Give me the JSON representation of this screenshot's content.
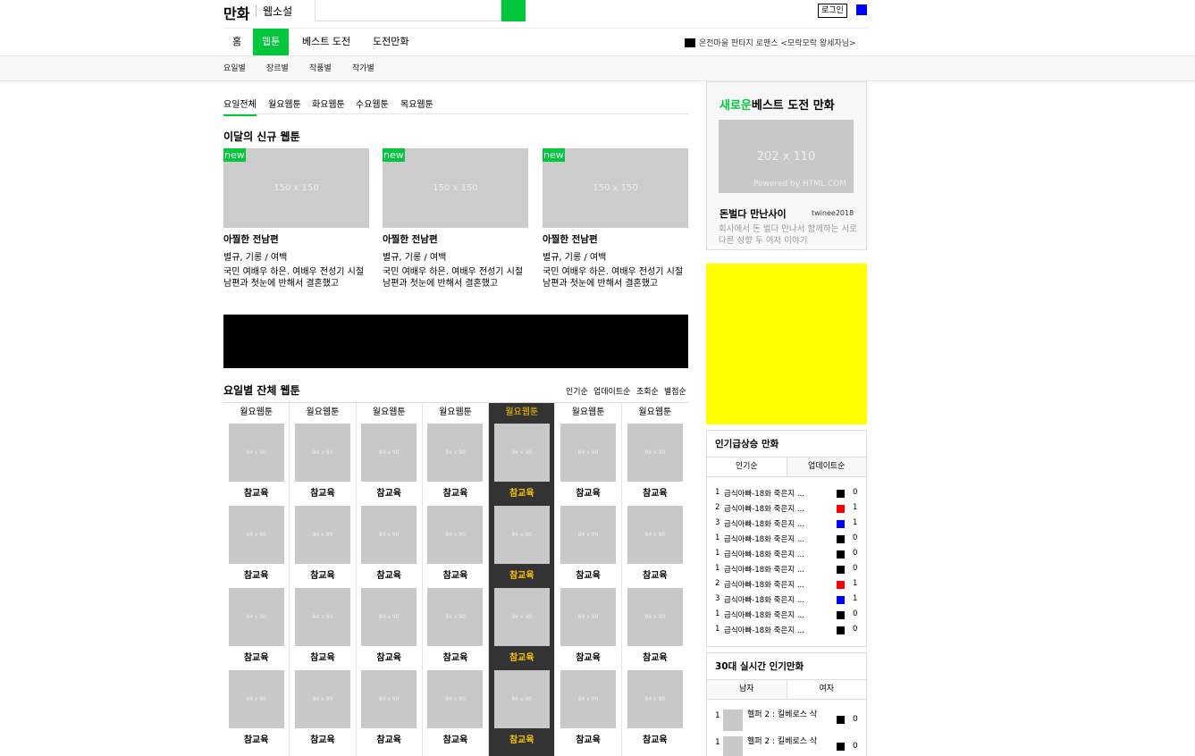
{
  "header": {
    "brand": "만화",
    "brand_sub": "웹소설",
    "search_placeholder": "",
    "login_label": "로그인",
    "colors": {
      "accent": "#00c73c",
      "user_badge": "#0000ff"
    }
  },
  "gnb": {
    "items": [
      "홈",
      "웹툰",
      "베스트 도전",
      "도전만화"
    ],
    "active": "웹툰",
    "notice": "온전마을 판타지 로맨스 <모락모락 왕세자님>"
  },
  "lnb": {
    "items": [
      "요일별",
      "장르별",
      "작품별",
      "작가별"
    ]
  },
  "day_tabs": {
    "items": [
      "요일전체",
      "월요웹툰",
      "화요웹툰",
      "수요웹툰",
      "목요웹툰"
    ],
    "active": "요일전체"
  },
  "new_section": {
    "title": "이달의 신규 웹툰",
    "cards": [
      {
        "badge": "new",
        "thumb": "150 x 150",
        "name": "아찔한 전남편",
        "genre": "별규, 기롱 / 여백",
        "desc": "국민 여배우 하은. 여배우 전성기 시절 남편과 첫눈에 반해서 결혼했고"
      },
      {
        "badge": "new",
        "thumb": "150 x 150",
        "name": "아찔한 전남편",
        "genre": "별규, 기롱 / 여백",
        "desc": "국민 여배우 하은. 여배우 전성기 시절 남편과 첫눈에 반해서 결혼했고"
      },
      {
        "badge": "new",
        "thumb": "150 x 150",
        "name": "아찔한 전남편",
        "genre": "별규, 기롱 / 여백",
        "desc": "국민 여배우 하은. 여배우 전성기 시절 남편과 첫눈에 반해서 결혼했고"
      }
    ]
  },
  "all_section": {
    "title": "요일별 잔체 웹툰",
    "sort": [
      "인기순",
      "업데이트순",
      "조회순",
      "별점순"
    ],
    "columns": [
      {
        "header": "월요웹툰",
        "active": false
      },
      {
        "header": "월요웹툰",
        "active": false
      },
      {
        "header": "월요웹툰",
        "active": false
      },
      {
        "header": "월요웹툰",
        "active": false
      },
      {
        "header": "월요웹툰",
        "active": true
      },
      {
        "header": "월요웹툰",
        "active": false
      },
      {
        "header": "월요웹툰",
        "active": false
      }
    ],
    "cell_thumb": "84 x 90",
    "cell_title": "참교육",
    "rows": 4
  },
  "best": {
    "title_accent": "새로운",
    "title_rest": "베스트 도전 만화",
    "thumb_size": "202 x 110",
    "thumb_powered": "Powered by HTML.COM",
    "name": "돈벌다 만난사이",
    "author": "twinee2018",
    "desc": "회사에서 돈 벌다 만나서 함께하는 서로 다른 성향 두 여자 이야기"
  },
  "rising": {
    "title": "인기급상승 만화",
    "tabs": [
      "인기순",
      "업데이트순"
    ],
    "rows": [
      {
        "num": "1",
        "text": "급식아빠-18화 죽은지 ...",
        "color": "#000000",
        "count": "0"
      },
      {
        "num": "2",
        "text": "급식아빠-18화 죽은지 ...",
        "color": "#ff0000",
        "count": "1"
      },
      {
        "num": "3",
        "text": "급식아빠-18화 죽은지 ...",
        "color": "#0000ff",
        "count": "1"
      },
      {
        "num": "1",
        "text": "급식아빠-18화 죽은지 ...",
        "color": "#000000",
        "count": "0"
      },
      {
        "num": "1",
        "text": "급식아빠-18화 죽은지 ...",
        "color": "#000000",
        "count": "0"
      },
      {
        "num": "1",
        "text": "급식아빠-18화 죽은지 ...",
        "color": "#000000",
        "count": "0"
      },
      {
        "num": "2",
        "text": "급식아빠-18화 죽은지 ...",
        "color": "#ff0000",
        "count": "1"
      },
      {
        "num": "3",
        "text": "급식아빠-18화 죽은지 ...",
        "color": "#0000ff",
        "count": "1"
      },
      {
        "num": "1",
        "text": "급식아빠-18화 죽은지 ...",
        "color": "#000000",
        "count": "0"
      },
      {
        "num": "1",
        "text": "급식아빠-18화 죽은지 ...",
        "color": "#000000",
        "count": "0"
      }
    ]
  },
  "realtime30": {
    "title": "30대 실시간 인기만화",
    "tabs": [
      "남자",
      "여자"
    ],
    "rows": [
      {
        "num": "1",
        "text": "헬퍼 2 : 킬베로스 삭",
        "count": "0"
      },
      {
        "num": "1",
        "text": "헬퍼 2 : 킬베로스 삭",
        "count": "0"
      }
    ]
  }
}
